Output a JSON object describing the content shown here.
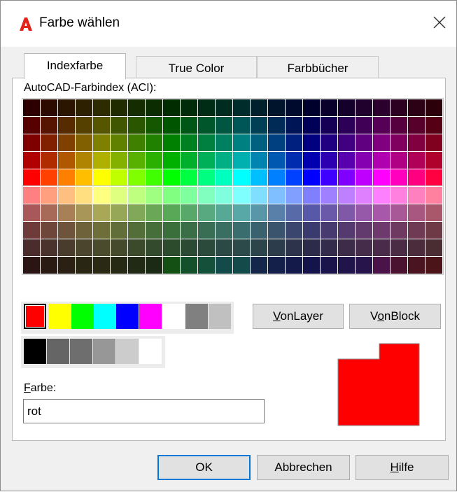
{
  "window": {
    "title": "Farbe wählen",
    "accent": "#e1251b"
  },
  "tabs": [
    {
      "label": "Indexfarbe",
      "active": true
    },
    {
      "label": "True Color",
      "active": false
    },
    {
      "label": "Farbbücher",
      "active": false
    }
  ],
  "aci_section": {
    "label": "AutoCAD-Farbindex (ACI):"
  },
  "aci_top_rows": [
    [
      "#2c0000",
      "#2c0a00",
      "#2c1500",
      "#2c2000",
      "#2c2c00",
      "#202c00",
      "#152c00",
      "#0a2c00",
      "#002c00",
      "#002c0a",
      "#002c15",
      "#002c20",
      "#002c2c",
      "#00202c",
      "#00152c",
      "#000a2c",
      "#00002c",
      "#0a002c",
      "#15002c",
      "#20002c",
      "#2c002c",
      "#2c0020",
      "#2c0015",
      "#2c000a"
    ],
    [
      "#560000",
      "#561500",
      "#562b00",
      "#564000",
      "#565600",
      "#405600",
      "#2b5600",
      "#155600",
      "#005600",
      "#005615",
      "#00562b",
      "#005640",
      "#005656",
      "#004056",
      "#002b56",
      "#001556",
      "#000056",
      "#150056",
      "#2b0056",
      "#400056",
      "#560056",
      "#560040",
      "#56002b",
      "#560015"
    ],
    [
      "#800000",
      "#802000",
      "#804000",
      "#806000",
      "#808000",
      "#608000",
      "#408000",
      "#208000",
      "#008000",
      "#008020",
      "#008040",
      "#008060",
      "#008080",
      "#006080",
      "#004080",
      "#002080",
      "#000080",
      "#200080",
      "#400080",
      "#600080",
      "#800080",
      "#800060",
      "#800040",
      "#800020"
    ],
    [
      "#b00000",
      "#b02c00",
      "#b05800",
      "#b08400",
      "#b0b000",
      "#84b000",
      "#58b000",
      "#2cb000",
      "#00b000",
      "#00b02c",
      "#00b058",
      "#00b084",
      "#00b0b0",
      "#0084b0",
      "#0058b0",
      "#002cb0",
      "#0000b0",
      "#2c00b0",
      "#5800b0",
      "#8400b0",
      "#b000b0",
      "#b00084",
      "#b00058",
      "#b0002c"
    ],
    [
      "#ff0000",
      "#ff4000",
      "#ff8000",
      "#ffbf00",
      "#ffff00",
      "#bfff00",
      "#80ff00",
      "#40ff00",
      "#00ff00",
      "#00ff40",
      "#00ff80",
      "#00ffbf",
      "#00ffff",
      "#00bfff",
      "#0080ff",
      "#0040ff",
      "#0000ff",
      "#4000ff",
      "#8000ff",
      "#bf00ff",
      "#ff00ff",
      "#ff00bf",
      "#ff0080",
      "#ff0040"
    ]
  ],
  "aci_bottom_rows": [
    [
      "#ff8080",
      "#ff9f80",
      "#ffbf80",
      "#ffdf80",
      "#ffff80",
      "#dfff80",
      "#bfff80",
      "#9fff80",
      "#80ff80",
      "#80ff9f",
      "#80ffbf",
      "#80ffdf",
      "#80ffff",
      "#80dfff",
      "#80bfff",
      "#809fff",
      "#8080ff",
      "#9f80ff",
      "#bf80ff",
      "#df80ff",
      "#ff80ff",
      "#ff80df",
      "#ff80bf",
      "#ff809f"
    ],
    [
      "#a85858",
      "#a86a58",
      "#a88058",
      "#a89658",
      "#a8a858",
      "#96a858",
      "#80a858",
      "#6aa858",
      "#58a858",
      "#58a86a",
      "#58a880",
      "#58a896",
      "#58a8a8",
      "#5896a8",
      "#5880a8",
      "#586aa8",
      "#5858a8",
      "#6a58a8",
      "#8058a8",
      "#9658a8",
      "#a858a8",
      "#a85896",
      "#a85880",
      "#a8586a"
    ],
    [
      "#6e3a3a",
      "#6e463a",
      "#6e543a",
      "#6e623a",
      "#6e6e3a",
      "#626e3a",
      "#546e3a",
      "#466e3a",
      "#3a6e3a",
      "#3a6e46",
      "#3a6e54",
      "#3a6e62",
      "#3a6e6e",
      "#3a626e",
      "#3a546e",
      "#3a466e",
      "#3a3a6e",
      "#463a6e",
      "#543a6e",
      "#623a6e",
      "#6e3a6e",
      "#6e3a62",
      "#6e3a54",
      "#6e3a46"
    ],
    [
      "#4a2c2c",
      "#4a332c",
      "#4a3c2c",
      "#4a452c",
      "#4a4a2c",
      "#454a2c",
      "#3c4a2c",
      "#334a2c",
      "#2c4a2c",
      "#2c4a33",
      "#2c4a3c",
      "#2c4a45",
      "#2c4a4a",
      "#2c454a",
      "#2c3c4a",
      "#2c334a",
      "#2c2c4a",
      "#332c4a",
      "#3c2c4a",
      "#452c4a",
      "#4a2c4a",
      "#4a2c45",
      "#4a2c3c",
      "#4a2c33"
    ],
    [
      "#2a1414",
      "#2a1a14",
      "#2a2014",
      "#2a2614",
      "#2a2a14",
      "#262a14",
      "#202a14",
      "#1a2a14",
      "#145014",
      "#14502a",
      "#14503a",
      "#144a4a",
      "#144a4a",
      "#14264a",
      "#14204a",
      "#141a4a",
      "#14144a",
      "#1a144a",
      "#20144a",
      "#26144a",
      "#4a144a",
      "#4a1430",
      "#4a1420",
      "#4a1418"
    ]
  ],
  "standard_colors": [
    {
      "name": "red",
      "color": "#ff0000",
      "selected": true
    },
    {
      "name": "yellow",
      "color": "#ffff00"
    },
    {
      "name": "green",
      "color": "#00ff00"
    },
    {
      "name": "cyan",
      "color": "#00ffff"
    },
    {
      "name": "blue",
      "color": "#0000ff"
    },
    {
      "name": "magenta",
      "color": "#ff00ff"
    },
    {
      "name": "white",
      "color": "#ffffff"
    },
    {
      "name": "gray-8",
      "color": "#808080"
    },
    {
      "name": "gray-9",
      "color": "#c0c0c0"
    }
  ],
  "gray_shades": [
    "#000000",
    "#656565",
    "#6e6e6e",
    "#979797",
    "#cccccc",
    "#ffffff"
  ],
  "bylayer_button": {
    "accel": "V",
    "rest": "onLayer"
  },
  "byblock_button": {
    "pre": "V",
    "accel": "o",
    "rest": "nBlock"
  },
  "color_field": {
    "label_accel": "F",
    "label_rest": "arbe:",
    "value": "rot"
  },
  "preview": {
    "new_color": "#ff0000",
    "old_color": "#ff0000"
  },
  "footer": {
    "ok_label": "OK",
    "cancel_label": "Abbrechen",
    "help_accel": "H",
    "help_rest": "ilfe"
  }
}
